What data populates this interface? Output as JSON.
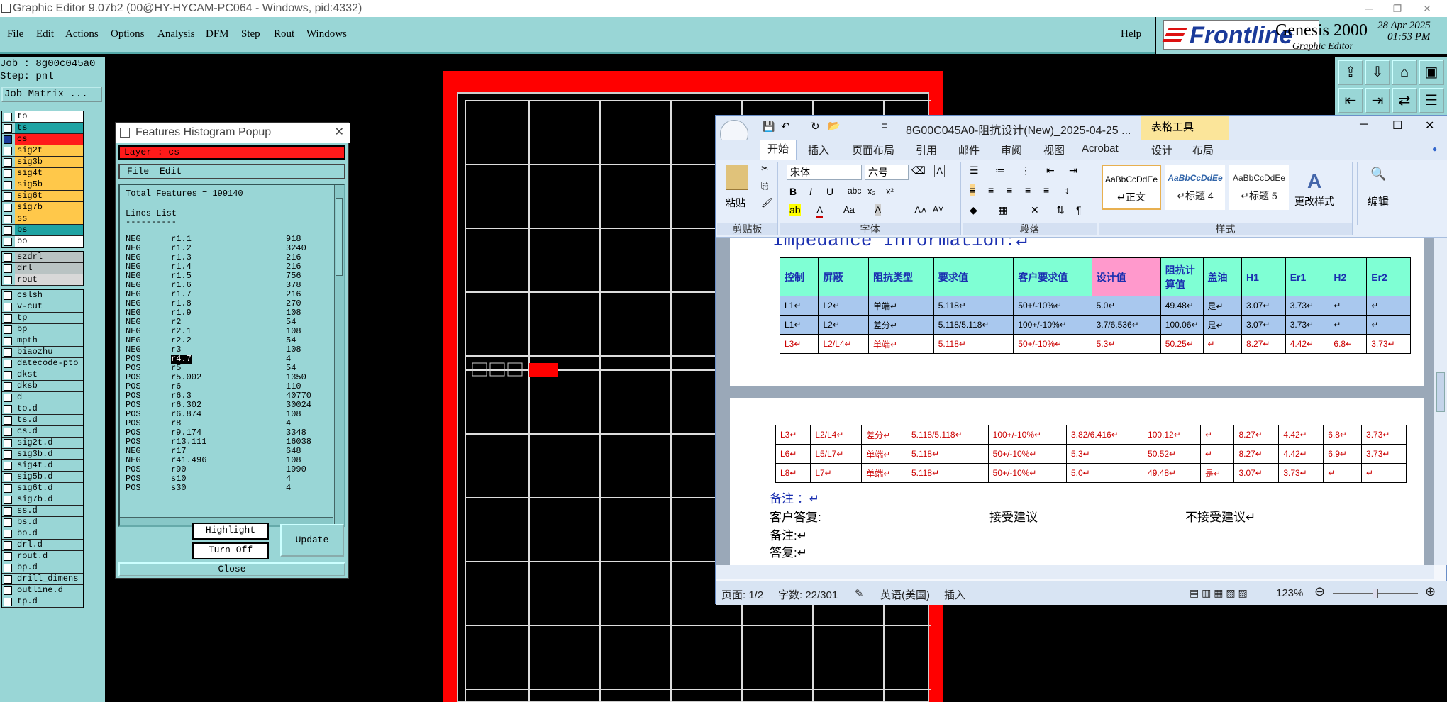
{
  "window": {
    "title": "Graphic Editor 9.07b2 (00@HY-HYCAM-PC064 - Windows, pid:4332)"
  },
  "menu": [
    "File",
    "Edit",
    "Actions",
    "Options",
    "Analysis",
    "DFM",
    "Step",
    "Rout",
    "Windows"
  ],
  "help": "Help",
  "brand": {
    "logo": "Frontline",
    "product": "Genesis 2000",
    "subtitle": "Graphic Editor",
    "date": "28 Apr 2025",
    "time": "01:53 PM"
  },
  "job": {
    "job_label": "Job : 8g00c045a0",
    "step_label": "Step: pnl",
    "matrix_button": "Job Matrix ..."
  },
  "layers_group1": [
    {
      "name": "to",
      "color": "#ffffff"
    },
    {
      "name": "ts",
      "color": "#1fa3a3"
    },
    {
      "name": "cs",
      "color": "#ff1a1a"
    },
    {
      "name": "sig2t",
      "color": "#ffc84a"
    },
    {
      "name": "sig3b",
      "color": "#ffc84a"
    },
    {
      "name": "sig4t",
      "color": "#ffc84a"
    },
    {
      "name": "sig5b",
      "color": "#ffc84a"
    },
    {
      "name": "sig6t",
      "color": "#ffc84a"
    },
    {
      "name": "sig7b",
      "color": "#ffc84a"
    },
    {
      "name": "ss",
      "color": "#ffc84a"
    },
    {
      "name": "bs",
      "color": "#1fa3a3"
    },
    {
      "name": "bo",
      "color": "#ffffff"
    }
  ],
  "layers_group2": [
    {
      "name": "szdrl",
      "color": "#b9c3c3"
    },
    {
      "name": "drl",
      "color": "#b9c3c3"
    },
    {
      "name": "rout",
      "color": "#d8d8d8"
    }
  ],
  "layers_group3": [
    "cslsh",
    "v-cut",
    "tp",
    "bp",
    "mpth",
    "biaozhu",
    "datecode-pto",
    "dkst",
    "dksb",
    "d",
    "to.d",
    "ts.d",
    "cs.d",
    "sig2t.d",
    "sig3b.d",
    "sig4t.d",
    "sig5b.d",
    "sig6t.d",
    "sig7b.d",
    "ss.d",
    "bs.d",
    "bo.d",
    "drl.d",
    "rout.d",
    "bp.d",
    "drill_dimens",
    "outline.d",
    "tp.d"
  ],
  "histogram": {
    "title": "Features Histogram Popup",
    "layer_label": "Layer :  cs",
    "menu": [
      "File",
      "Edit"
    ],
    "total": "Total Features = 199140",
    "list_title": "Lines List",
    "list_rule": "----------",
    "rows": [
      [
        "NEG",
        "r1.1",
        "918"
      ],
      [
        "NEG",
        "r1.2",
        "3240"
      ],
      [
        "NEG",
        "r1.3",
        "216"
      ],
      [
        "NEG",
        "r1.4",
        "216"
      ],
      [
        "NEG",
        "r1.5",
        "756"
      ],
      [
        "NEG",
        "r1.6",
        "378"
      ],
      [
        "NEG",
        "r1.7",
        "216"
      ],
      [
        "NEG",
        "r1.8",
        "270"
      ],
      [
        "NEG",
        "r1.9",
        "108"
      ],
      [
        "NEG",
        "r2",
        "54"
      ],
      [
        "NEG",
        "r2.1",
        "108"
      ],
      [
        "NEG",
        "r2.2",
        "54"
      ],
      [
        "NEG",
        "r3",
        "108"
      ],
      [
        "POS",
        "r4.7",
        "4"
      ],
      [
        "POS",
        "r5",
        "54"
      ],
      [
        "POS",
        "r5.002",
        "1350"
      ],
      [
        "POS",
        "r6",
        "110"
      ],
      [
        "POS",
        "r6.3",
        "40770"
      ],
      [
        "POS",
        "r6.302",
        "30024"
      ],
      [
        "POS",
        "r6.874",
        "108"
      ],
      [
        "POS",
        "r8",
        "4"
      ],
      [
        "POS",
        "r9.174",
        "3348"
      ],
      [
        "POS",
        "r13.111",
        "16038"
      ],
      [
        "NEG",
        "r17",
        "648"
      ],
      [
        "NEG",
        "r41.496",
        "108"
      ],
      [
        "POS",
        "r90",
        "1990"
      ],
      [
        "POS",
        "s10",
        "4"
      ],
      [
        "POS",
        "s30",
        "4"
      ]
    ],
    "buttons": {
      "highlight": "Highlight",
      "turn_off": "Turn Off",
      "update": "Update",
      "close": "Close"
    }
  },
  "word": {
    "title": "8G00C045A0-阻抗设计(New)_2025-04-25 ...",
    "tools_tab": "表格工具",
    "tabs": [
      "开始",
      "插入",
      "页面布局",
      "引用",
      "邮件",
      "审阅",
      "视图",
      "Acrobat",
      "设计",
      "布局"
    ],
    "ribbon": {
      "paste": "粘贴",
      "clipboard": "剪贴板",
      "font_name": "宋体",
      "font_size": "六号",
      "font_group": "字体",
      "para_group": "段落",
      "styles_group": "样式",
      "style1_sample": "AaBbCcDdEe",
      "style1": "↵正文",
      "style2_sample": "AaBbCcDdEe",
      "style2": "↵标题 4",
      "style3_sample": "AaBbCcDdEe",
      "style3": "↵标题 5",
      "change_styles": "更改样式",
      "edit": "编辑"
    },
    "heading": "Impedance Information:↵",
    "table_header": [
      "控制",
      "屏蔽",
      "阻抗类型",
      "要求值",
      "客户要求值",
      "设计值",
      "阻抗计算值",
      "盖油",
      "H1",
      "Er1",
      "H2",
      "Er2"
    ],
    "table1": [
      [
        "L1↵",
        "L2↵",
        "单端↵",
        "5.118↵",
        "50+/-10%↵",
        "5.0↵",
        "49.48↵",
        "是↵",
        "3.07↵",
        "3.73↵",
        "↵",
        "↵"
      ],
      [
        "L1↵",
        "L2↵",
        "差分↵",
        "5.118/5.118↵",
        "100+/-10%↵",
        "3.7/6.536↵",
        "100.06↵",
        "是↵",
        "3.07↵",
        "3.73↵",
        "↵",
        "↵"
      ],
      [
        "L3↵",
        "L2/L4↵",
        "单端↵",
        "5.118↵",
        "50+/-10%↵",
        "5.3↵",
        "50.25↵",
        "↵",
        "8.27↵",
        "4.42↵",
        "6.8↵",
        "3.73↵"
      ]
    ],
    "table2": [
      [
        "L3↵",
        "L2/L4↵",
        "差分↵",
        "5.118/5.118↵",
        "100+/-10%↵",
        "3.82/6.416↵",
        "100.12↵",
        "↵",
        "8.27↵",
        "4.42↵",
        "6.8↵",
        "3.73↵"
      ],
      [
        "L6↵",
        "L5/L7↵",
        "单端↵",
        "5.118↵",
        "50+/-10%↵",
        "5.3↵",
        "50.52↵",
        "↵",
        "8.27↵",
        "4.42↵",
        "6.9↵",
        "3.73↵"
      ],
      [
        "L8↵",
        "L7↵",
        "单端↵",
        "5.118↵",
        "50+/-10%↵",
        "5.0↵",
        "49.48↵",
        "是↵",
        "3.07↵",
        "3.73↵",
        "↵",
        "↵"
      ]
    ],
    "notes": {
      "n1": "备注 ：↵",
      "reply": "客户答复:",
      "accept": "接受建议",
      "reject": "不接受建议↵",
      "n2": "备注:↵",
      "n3": "答复:↵"
    },
    "status": {
      "page": "页面: 1/2",
      "words": "字数: 22/301",
      "lang": "英语(美国)",
      "mode": "插入",
      "zoom": "123%"
    }
  },
  "colors": {
    "panel": "#99d6d6",
    "board_red": "#ff0000"
  }
}
